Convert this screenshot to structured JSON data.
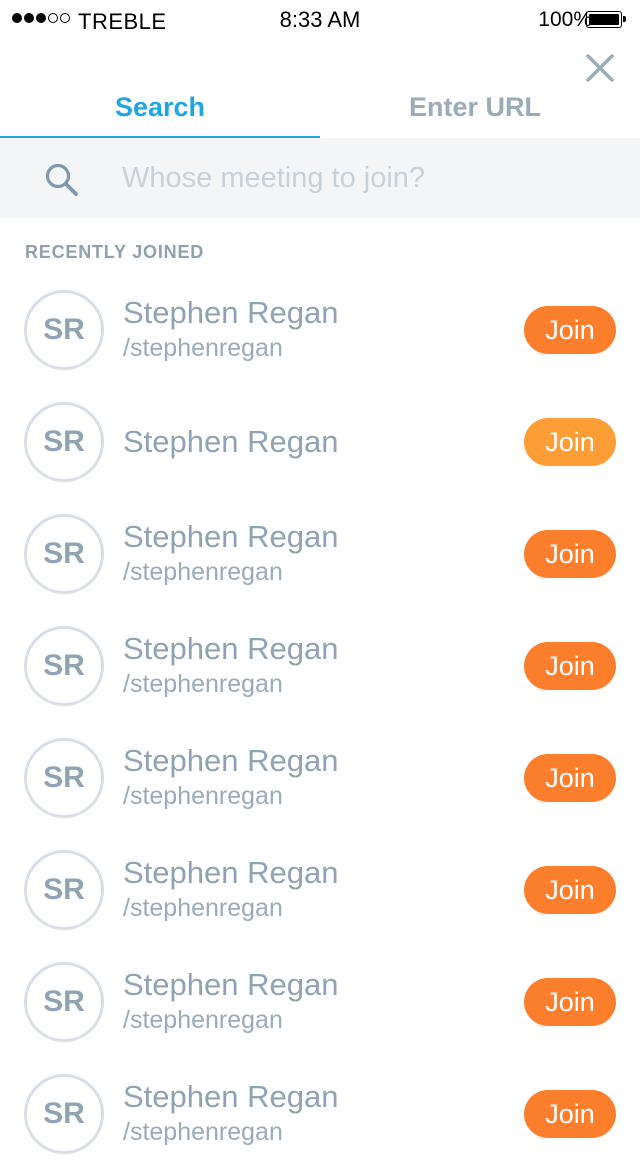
{
  "status_bar": {
    "carrier": "TREBLE",
    "time": "8:33 AM",
    "battery": "100%"
  },
  "tabs": [
    {
      "label": "Search",
      "active": true
    },
    {
      "label": "Enter URL",
      "active": false
    }
  ],
  "search": {
    "placeholder": "Whose meeting to join?",
    "value": ""
  },
  "section": {
    "header": "RECENTLY JOINED"
  },
  "recent": [
    {
      "initials": "SR",
      "name": "Stephen Regan",
      "handle": "/stephenregan",
      "join_label": "Join"
    },
    {
      "initials": "SR",
      "name": "Stephen Regan",
      "handle": "",
      "join_label": "Join"
    },
    {
      "initials": "SR",
      "name": "Stephen Regan",
      "handle": "/stephenregan",
      "join_label": "Join"
    },
    {
      "initials": "SR",
      "name": "Stephen Regan",
      "handle": "/stephenregan",
      "join_label": "Join"
    },
    {
      "initials": "SR",
      "name": "Stephen Regan",
      "handle": "/stephenregan",
      "join_label": "Join"
    },
    {
      "initials": "SR",
      "name": "Stephen Regan",
      "handle": "/stephenregan",
      "join_label": "Join"
    },
    {
      "initials": "SR",
      "name": "Stephen Regan",
      "handle": "/stephenregan",
      "join_label": "Join"
    },
    {
      "initials": "SR",
      "name": "Stephen Regan",
      "handle": "/stephenregan",
      "join_label": "Join"
    }
  ],
  "colors": {
    "accent": "#1fa6e0",
    "join": "#fb7e2d",
    "join_pressed": "#fc9d36",
    "muted_text": "#8fa3b6"
  },
  "icons": {
    "close": "close-icon",
    "search": "search-icon"
  }
}
